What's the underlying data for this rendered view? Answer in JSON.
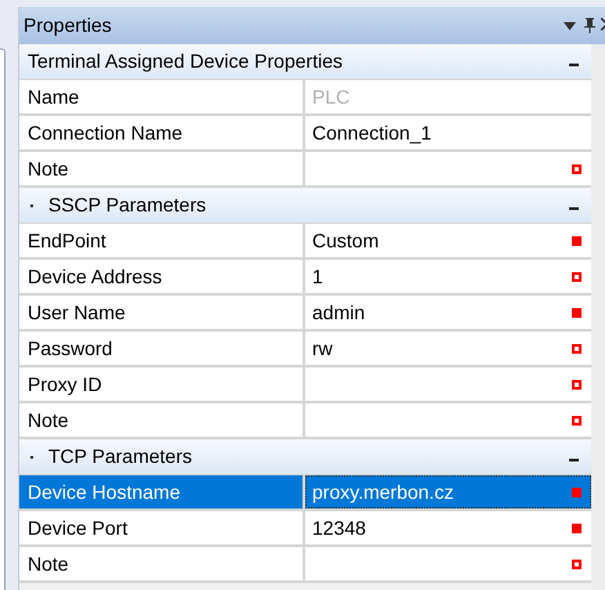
{
  "panel": {
    "title": "Properties"
  },
  "groups": [
    {
      "title": "Terminal Assigned Device Properties",
      "bullet": false,
      "expanded": true,
      "rows": [
        {
          "name": "Name",
          "value": "PLC",
          "selected": false,
          "kind": "readonly"
        },
        {
          "name": "Connection Name",
          "value": "Connection_1",
          "selected": false,
          "kind": "plain"
        },
        {
          "name": "Note",
          "selected": false,
          "kind": "optional"
        }
      ]
    },
    {
      "title": "SSCP Parameters",
      "bullet": true,
      "expanded": true,
      "rows": [
        {
          "name": "EndPoint",
          "value": "Custom",
          "selected": false,
          "kind": "required"
        },
        {
          "name": "Device Address",
          "value": "1",
          "selected": false,
          "kind": "optional"
        },
        {
          "name": "User Name",
          "value": "admin",
          "selected": false,
          "kind": "required"
        },
        {
          "name": "Password",
          "value": "rw",
          "selected": false,
          "kind": "optional"
        },
        {
          "name": "Proxy ID",
          "selected": false,
          "kind": "optional"
        },
        {
          "name": "Note",
          "selected": false,
          "kind": "optional"
        }
      ]
    },
    {
      "title": "TCP Parameters",
      "bullet": true,
      "expanded": true,
      "rows": [
        {
          "name": "Device Hostname",
          "value": "proxy.merbon.cz",
          "selected": true,
          "kind": "required"
        },
        {
          "name": "Device Port",
          "value": "12348",
          "selected": false,
          "kind": "required"
        },
        {
          "name": "Note",
          "selected": false,
          "kind": "optional"
        }
      ]
    }
  ]
}
